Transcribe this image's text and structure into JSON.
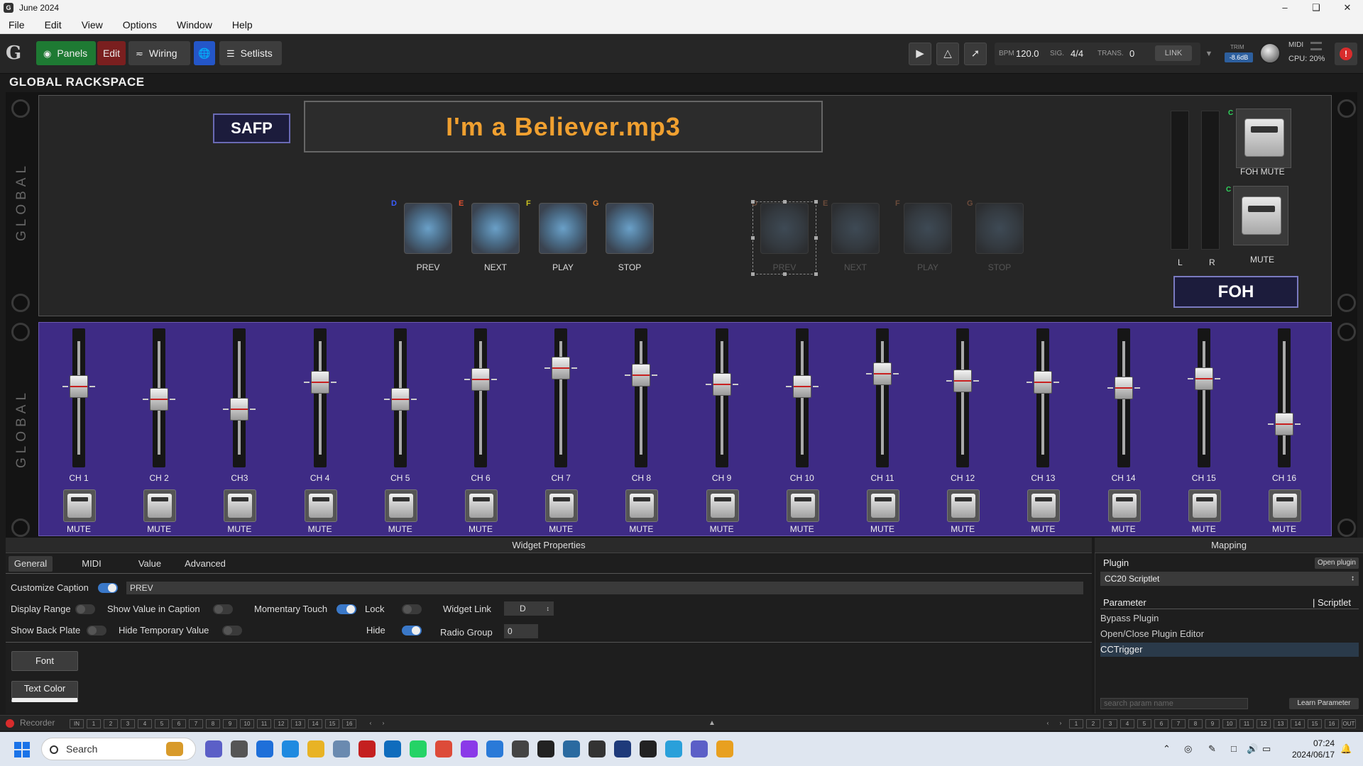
{
  "window": {
    "title": "June 2024",
    "controls": [
      "–",
      "❑",
      "✕"
    ]
  },
  "menu": [
    "File",
    "Edit",
    "View",
    "Options",
    "Window",
    "Help"
  ],
  "toolbar": {
    "panels_label": "Panels",
    "edit_label": "Edit",
    "wiring_label": "Wiring",
    "setlists_label": "Setlists",
    "bpm_label": "BPM",
    "bpm_value": "120.0",
    "sig_label": "SIG.",
    "sig_value": "4/4",
    "trans_label": "TRANS.",
    "trans_value": "0",
    "link_label": "LINK",
    "trim_label": "TRIM",
    "trim_value": "-8.6dB",
    "midi_label": "MIDI",
    "cpu_label": "CPU: 20%"
  },
  "rackspace": {
    "title": "GLOBAL RACKSPACE",
    "side_label": "GLOBAL",
    "safp_label": "SAFP",
    "song_title": "I'm a Believer.mp3",
    "pads_active": [
      {
        "letter": "D",
        "label": "PREV",
        "letter_color": "#3a5cff"
      },
      {
        "letter": "E",
        "label": "NEXT",
        "letter_color": "#e05030"
      },
      {
        "letter": "F",
        "label": "PLAY",
        "letter_color": "#c8c020"
      },
      {
        "letter": "G",
        "label": "STOP",
        "letter_color": "#e08030"
      }
    ],
    "pads_dim": [
      {
        "letter": "D",
        "label": "PREV"
      },
      {
        "letter": "E",
        "label": "NEXT"
      },
      {
        "letter": "F",
        "label": "PLAY"
      },
      {
        "letter": "G",
        "label": "STOP"
      }
    ],
    "meter_left": "L",
    "meter_right": "R",
    "foh_mute_label": "FOH MUTE",
    "mute_label": "MUTE",
    "c_mark": "C",
    "foh_label": "FOH"
  },
  "mixer": {
    "channels": [
      {
        "name": "CH 1",
        "level": 0.6
      },
      {
        "name": "CH 2",
        "level": 0.49
      },
      {
        "name": "CH3",
        "level": 0.4
      },
      {
        "name": "CH 4",
        "level": 0.64
      },
      {
        "name": "CH 5",
        "level": 0.49
      },
      {
        "name": "CH 6",
        "level": 0.66
      },
      {
        "name": "CH 7",
        "level": 0.76
      },
      {
        "name": "CH 8",
        "level": 0.7
      },
      {
        "name": "CH 9",
        "level": 0.62
      },
      {
        "name": "CH 10",
        "level": 0.6
      },
      {
        "name": "CH 11",
        "level": 0.71
      },
      {
        "name": "CH 12",
        "level": 0.65
      },
      {
        "name": "CH 13",
        "level": 0.64
      },
      {
        "name": "CH 14",
        "level": 0.59
      },
      {
        "name": "CH 15",
        "level": 0.67
      },
      {
        "name": "CH 16",
        "level": 0.27
      }
    ],
    "mute_label": "MUTE"
  },
  "widget_props": {
    "title": "Widget Properties",
    "tabs": [
      "General",
      "MIDI",
      "Value",
      "Advanced"
    ],
    "active_tab": "General",
    "customize_caption_label": "Customize Caption",
    "customize_caption_on": true,
    "caption_value": "PREV",
    "display_range_label": "Display Range",
    "display_range_on": false,
    "show_value_label": "Show Value in Caption",
    "show_value_on": false,
    "momentary_touch_label": "Momentary Touch",
    "momentary_touch_on": true,
    "lock_label": "Lock",
    "lock_on": false,
    "widget_link_label": "Widget Link",
    "widget_link_value": "D",
    "show_back_plate_label": "Show Back Plate",
    "show_back_plate_on": false,
    "hide_temp_label": "Hide Temporary Value",
    "hide_temp_on": false,
    "hide_label": "Hide",
    "hide_on": true,
    "radio_group_label": "Radio Group",
    "radio_group_value": "0",
    "font_button": "Font",
    "text_color_button": "Text Color"
  },
  "mapping": {
    "title": "Mapping",
    "plugin_label": "Plugin",
    "open_plugin": "Open plugin",
    "plugin_value": "CC20 Scriptlet",
    "parameter_label": "Parameter",
    "scriptlet_label": "| Scriptlet",
    "params": [
      "Bypass Plugin",
      "Open/Close Plugin Editor",
      "CCTrigger"
    ],
    "selected_param": 2,
    "search_placeholder": "search param name",
    "learn_button": "Learn Parameter"
  },
  "recorder": {
    "label": "Recorder",
    "in_label": "IN",
    "out_label": "OUT"
  },
  "taskbar": {
    "search_label": "Search",
    "time": "07:24",
    "date": "2024/06/17"
  }
}
